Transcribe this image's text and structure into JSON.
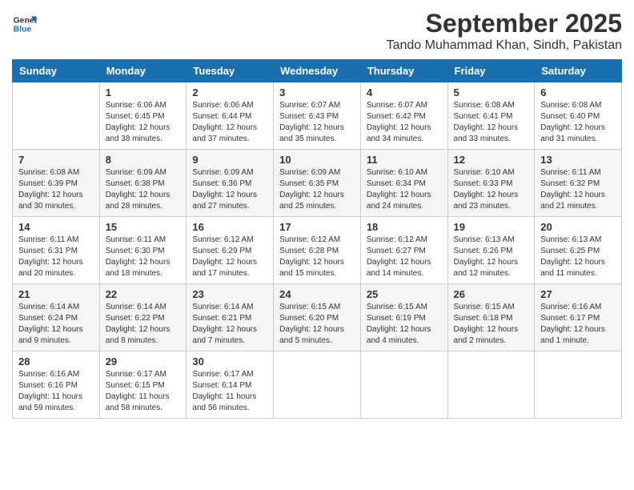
{
  "logo": {
    "line1": "General",
    "line2": "Blue"
  },
  "title": "September 2025",
  "location": "Tando Muhammad Khan, Sindh, Pakistan",
  "days_of_week": [
    "Sunday",
    "Monday",
    "Tuesday",
    "Wednesday",
    "Thursday",
    "Friday",
    "Saturday"
  ],
  "weeks": [
    [
      {
        "day": "",
        "info": ""
      },
      {
        "day": "1",
        "info": "Sunrise: 6:06 AM\nSunset: 6:45 PM\nDaylight: 12 hours\nand 38 minutes."
      },
      {
        "day": "2",
        "info": "Sunrise: 6:06 AM\nSunset: 6:44 PM\nDaylight: 12 hours\nand 37 minutes."
      },
      {
        "day": "3",
        "info": "Sunrise: 6:07 AM\nSunset: 6:43 PM\nDaylight: 12 hours\nand 35 minutes."
      },
      {
        "day": "4",
        "info": "Sunrise: 6:07 AM\nSunset: 6:42 PM\nDaylight: 12 hours\nand 34 minutes."
      },
      {
        "day": "5",
        "info": "Sunrise: 6:08 AM\nSunset: 6:41 PM\nDaylight: 12 hours\nand 33 minutes."
      },
      {
        "day": "6",
        "info": "Sunrise: 6:08 AM\nSunset: 6:40 PM\nDaylight: 12 hours\nand 31 minutes."
      }
    ],
    [
      {
        "day": "7",
        "info": "Sunrise: 6:08 AM\nSunset: 6:39 PM\nDaylight: 12 hours\nand 30 minutes."
      },
      {
        "day": "8",
        "info": "Sunrise: 6:09 AM\nSunset: 6:38 PM\nDaylight: 12 hours\nand 28 minutes."
      },
      {
        "day": "9",
        "info": "Sunrise: 6:09 AM\nSunset: 6:36 PM\nDaylight: 12 hours\nand 27 minutes."
      },
      {
        "day": "10",
        "info": "Sunrise: 6:09 AM\nSunset: 6:35 PM\nDaylight: 12 hours\nand 25 minutes."
      },
      {
        "day": "11",
        "info": "Sunrise: 6:10 AM\nSunset: 6:34 PM\nDaylight: 12 hours\nand 24 minutes."
      },
      {
        "day": "12",
        "info": "Sunrise: 6:10 AM\nSunset: 6:33 PM\nDaylight: 12 hours\nand 23 minutes."
      },
      {
        "day": "13",
        "info": "Sunrise: 6:11 AM\nSunset: 6:32 PM\nDaylight: 12 hours\nand 21 minutes."
      }
    ],
    [
      {
        "day": "14",
        "info": "Sunrise: 6:11 AM\nSunset: 6:31 PM\nDaylight: 12 hours\nand 20 minutes."
      },
      {
        "day": "15",
        "info": "Sunrise: 6:11 AM\nSunset: 6:30 PM\nDaylight: 12 hours\nand 18 minutes."
      },
      {
        "day": "16",
        "info": "Sunrise: 6:12 AM\nSunset: 6:29 PM\nDaylight: 12 hours\nand 17 minutes."
      },
      {
        "day": "17",
        "info": "Sunrise: 6:12 AM\nSunset: 6:28 PM\nDaylight: 12 hours\nand 15 minutes."
      },
      {
        "day": "18",
        "info": "Sunrise: 6:12 AM\nSunset: 6:27 PM\nDaylight: 12 hours\nand 14 minutes."
      },
      {
        "day": "19",
        "info": "Sunrise: 6:13 AM\nSunset: 6:26 PM\nDaylight: 12 hours\nand 12 minutes."
      },
      {
        "day": "20",
        "info": "Sunrise: 6:13 AM\nSunset: 6:25 PM\nDaylight: 12 hours\nand 11 minutes."
      }
    ],
    [
      {
        "day": "21",
        "info": "Sunrise: 6:14 AM\nSunset: 6:24 PM\nDaylight: 12 hours\nand 9 minutes."
      },
      {
        "day": "22",
        "info": "Sunrise: 6:14 AM\nSunset: 6:22 PM\nDaylight: 12 hours\nand 8 minutes."
      },
      {
        "day": "23",
        "info": "Sunrise: 6:14 AM\nSunset: 6:21 PM\nDaylight: 12 hours\nand 7 minutes."
      },
      {
        "day": "24",
        "info": "Sunrise: 6:15 AM\nSunset: 6:20 PM\nDaylight: 12 hours\nand 5 minutes."
      },
      {
        "day": "25",
        "info": "Sunrise: 6:15 AM\nSunset: 6:19 PM\nDaylight: 12 hours\nand 4 minutes."
      },
      {
        "day": "26",
        "info": "Sunrise: 6:15 AM\nSunset: 6:18 PM\nDaylight: 12 hours\nand 2 minutes."
      },
      {
        "day": "27",
        "info": "Sunrise: 6:16 AM\nSunset: 6:17 PM\nDaylight: 12 hours\nand 1 minute."
      }
    ],
    [
      {
        "day": "28",
        "info": "Sunrise: 6:16 AM\nSunset: 6:16 PM\nDaylight: 11 hours\nand 59 minutes."
      },
      {
        "day": "29",
        "info": "Sunrise: 6:17 AM\nSunset: 6:15 PM\nDaylight: 11 hours\nand 58 minutes."
      },
      {
        "day": "30",
        "info": "Sunrise: 6:17 AM\nSunset: 6:14 PM\nDaylight: 11 hours\nand 56 minutes."
      },
      {
        "day": "",
        "info": ""
      },
      {
        "day": "",
        "info": ""
      },
      {
        "day": "",
        "info": ""
      },
      {
        "day": "",
        "info": ""
      }
    ]
  ]
}
